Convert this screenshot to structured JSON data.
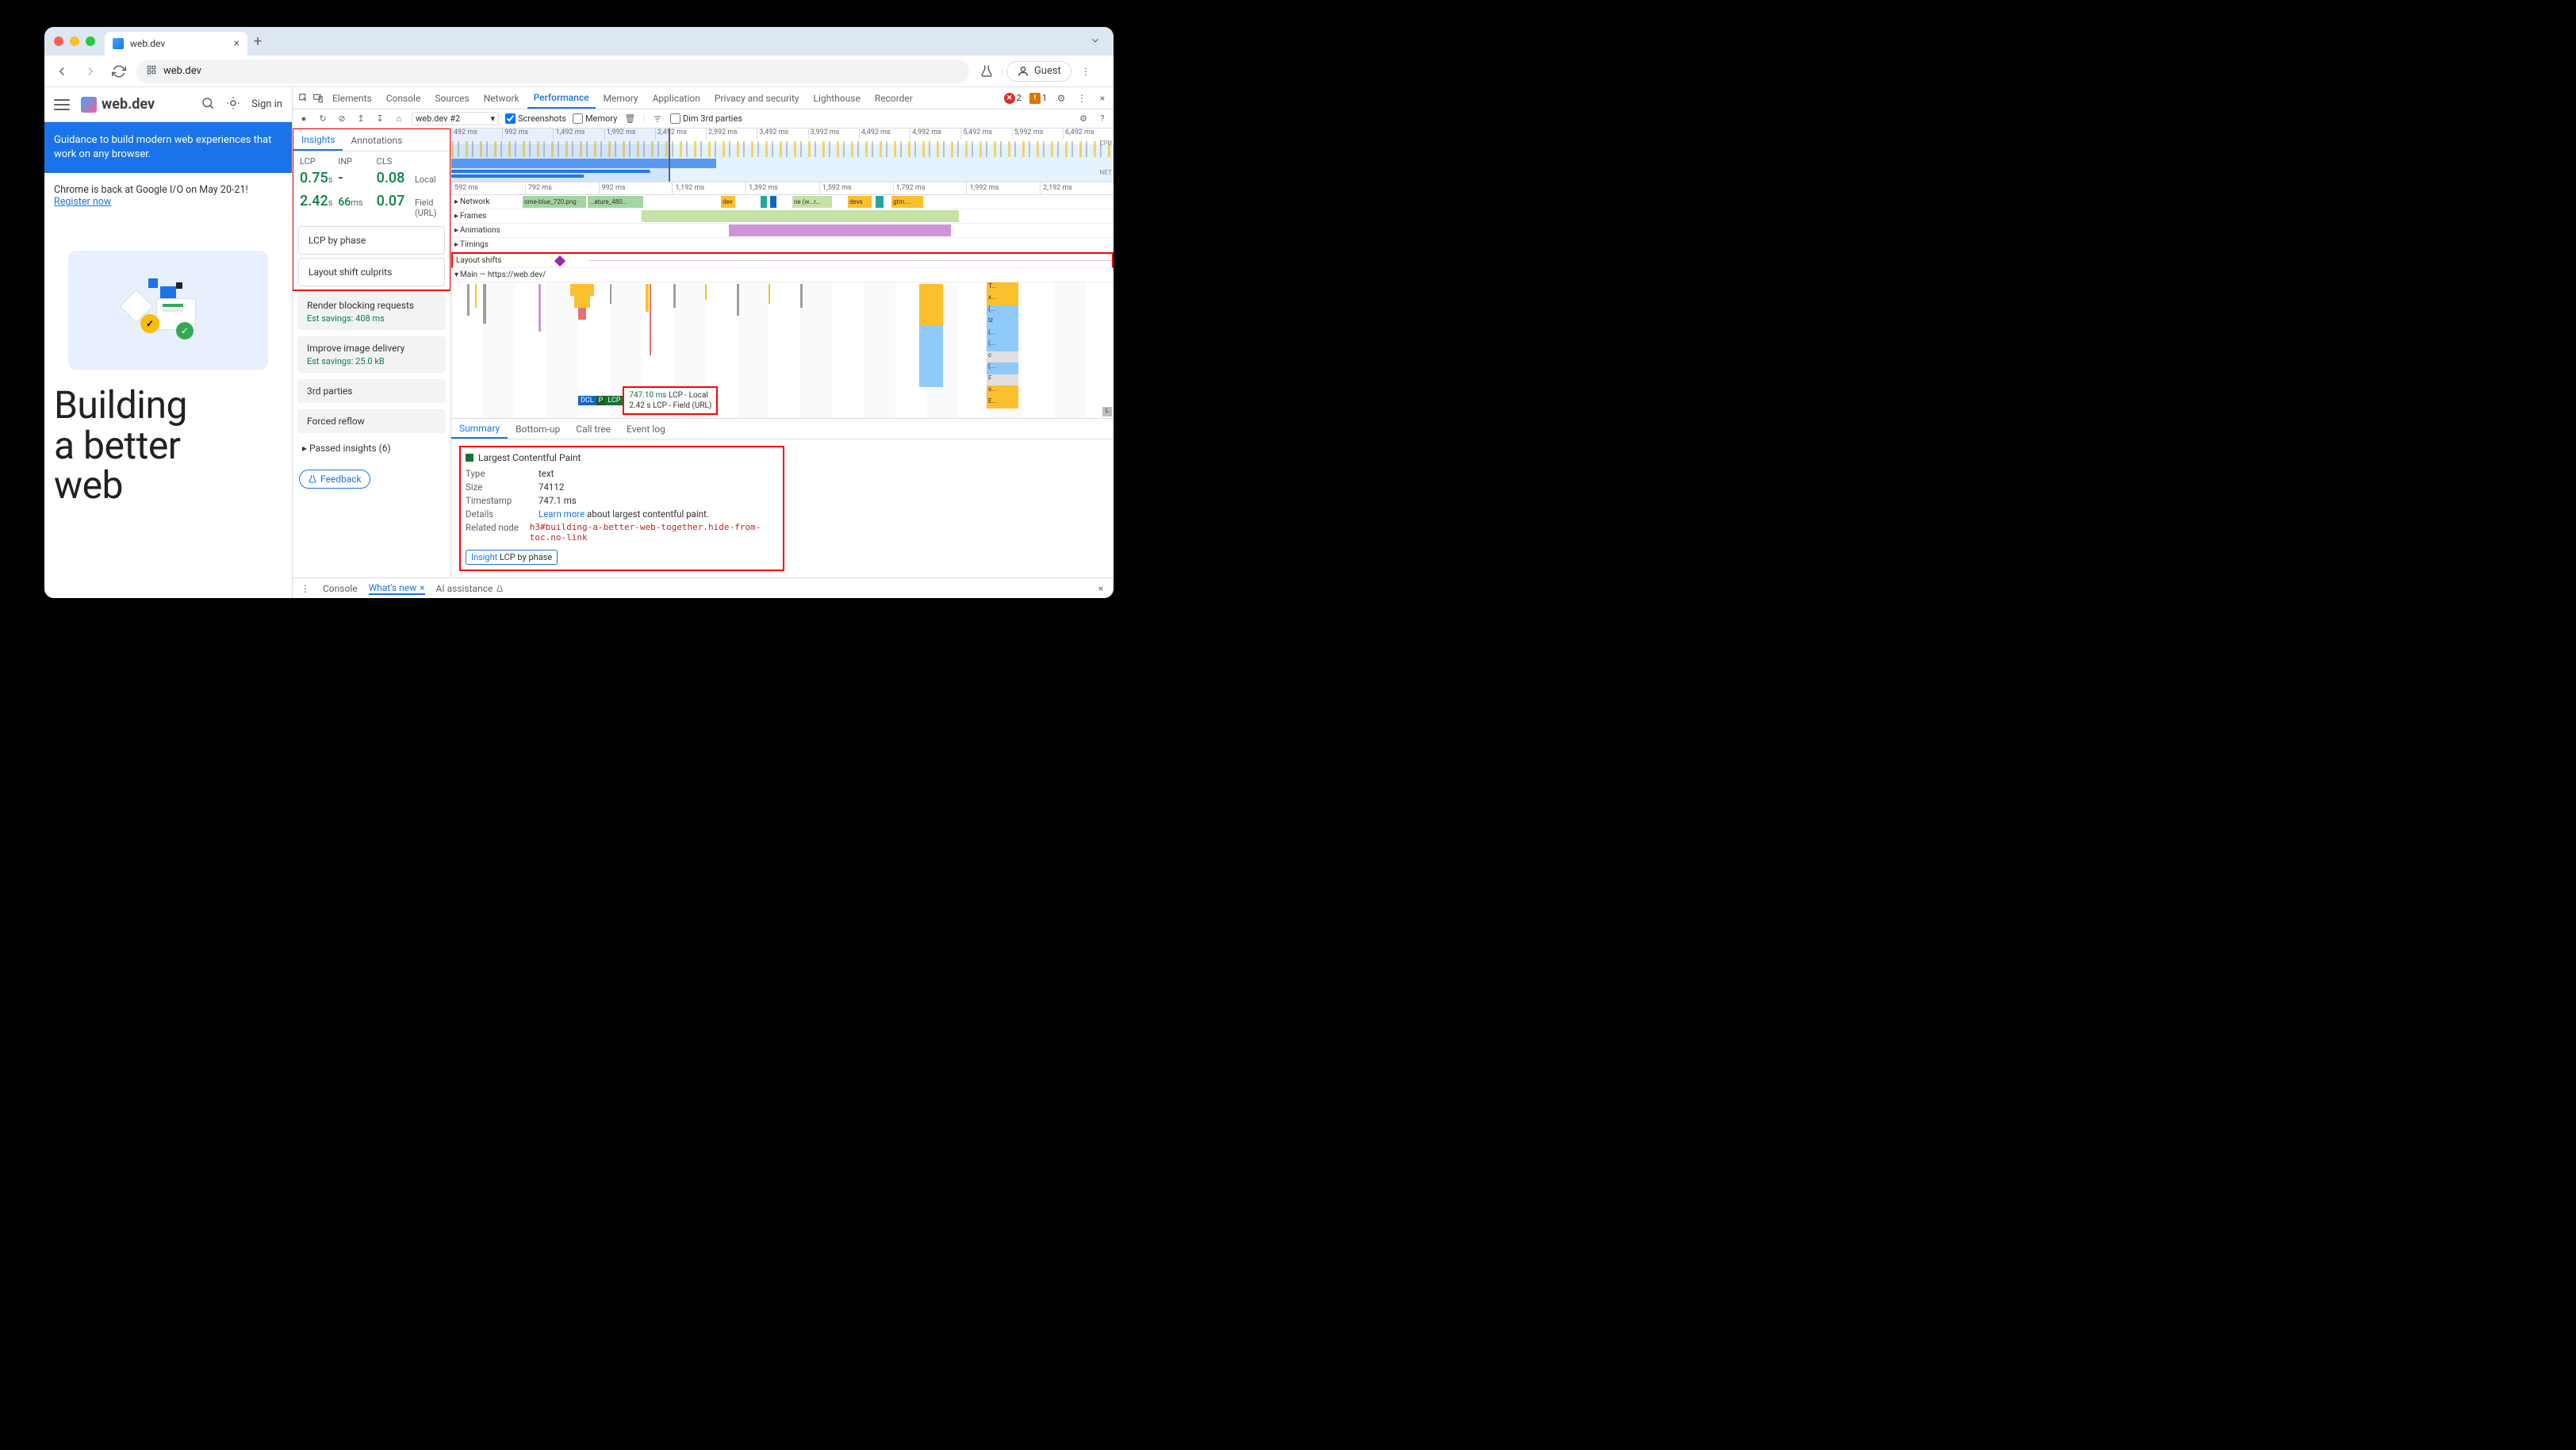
{
  "browser": {
    "tab_title": "web.dev",
    "url": "web.dev",
    "guest_label": "Guest"
  },
  "page": {
    "logo_text": "web.dev",
    "sign_in": "Sign in",
    "banner_text": "Guidance to build modern web experiences that work on any browser.",
    "io_text": "Chrome is back at Google I/O on May 20-21!",
    "io_link": "Register now",
    "hero_line1": "Building",
    "hero_line2": "a better",
    "hero_line3": "web"
  },
  "devtools": {
    "tabs": [
      "Elements",
      "Console",
      "Sources",
      "Network",
      "Performance",
      "Memory",
      "Application",
      "Privacy and security",
      "Lighthouse",
      "Recorder"
    ],
    "active_tab": "Performance",
    "errors": "2",
    "warnings": "1",
    "toolbar": {
      "trace_select": "web.dev #2",
      "screenshots": "Screenshots",
      "memory": "Memory",
      "dim": "Dim 3rd parties"
    },
    "insights": {
      "tabs": [
        "Insights",
        "Annotations"
      ],
      "headers": {
        "lcp": "LCP",
        "inp": "INP",
        "cls": "CLS"
      },
      "local": {
        "lcp": "0.75",
        "lcp_unit": "s",
        "inp": "-",
        "cls": "0.08",
        "label": "Local"
      },
      "field": {
        "lcp": "2.42",
        "lcp_unit": "s",
        "inp": "66",
        "inp_unit": "ms",
        "cls": "0.07",
        "label": "Field (URL)"
      },
      "items": {
        "lcp_phase": "LCP by phase",
        "layout_shift": "Layout shift culprits",
        "render_blocking": "Render blocking requests",
        "render_savings": "Est savings: 408 ms",
        "image_delivery": "Improve image delivery",
        "image_savings": "Est savings: 25.0 kB",
        "third_parties": "3rd parties",
        "forced_reflow": "Forced reflow",
        "passed": "Passed insights (6)"
      },
      "feedback": "Feedback"
    },
    "overview_ticks": [
      "492 ms",
      "992 ms",
      "1,492 ms",
      "1,992 ms",
      "2,492 ms",
      "2,992 ms",
      "3,492 ms",
      "3,992 ms",
      "4,492 ms",
      "4,992 ms",
      "5,492 ms",
      "5,992 ms",
      "6,492 ms"
    ],
    "overview_labels": {
      "cpu": "CPU",
      "net": "NET"
    },
    "ruler2_ticks": [
      "592 ms",
      "792 ms",
      "992 ms",
      "1,192 ms",
      "1,392 ms",
      "1,592 ms",
      "1,792 ms",
      "1,992 ms",
      "2,192 ms"
    ],
    "tracks": {
      "network": "Network",
      "frames": "Frames",
      "animations": "Animations",
      "timings": "Timings",
      "layout_shifts": "Layout shifts",
      "main": "Main — https://web.dev/"
    },
    "network_items": [
      "ome-blue_720.png",
      "...ature_480...",
      "dev",
      "ne (w...r...",
      "devs",
      "gtm...."
    ],
    "lcp_marker": {
      "dcl": "DCL",
      "p": "P",
      "lcp": "LCP",
      "local_time": "747.10 ms",
      "local_label": "LCP - Local",
      "field_time": "2.42 s",
      "field_label": "LCP - Field (URL)"
    },
    "flame_stack": [
      "T...",
      "x...",
      "(...",
      "Iz",
      "(...",
      "(...",
      "c",
      "(...",
      "F",
      "s...",
      "E..."
    ],
    "details_tabs": [
      "Summary",
      "Bottom-up",
      "Call tree",
      "Event log"
    ],
    "summary": {
      "title": "Largest Contentful Paint",
      "type_key": "Type",
      "type_val": "text",
      "size_key": "Size",
      "size_val": "74112",
      "timestamp_key": "Timestamp",
      "timestamp_val": "747.1 ms",
      "details_key": "Details",
      "details_link": "Learn more",
      "details_text": " about largest contentful paint.",
      "node_key": "Related node",
      "node_val": "h3#building-a-better-web-together.hide-from-toc.no-link",
      "insight_label": "Insight",
      "insight_val": "LCP by phase"
    },
    "drawer": {
      "console": "Console",
      "whats_new": "What's new",
      "ai": "AI assistance"
    }
  }
}
